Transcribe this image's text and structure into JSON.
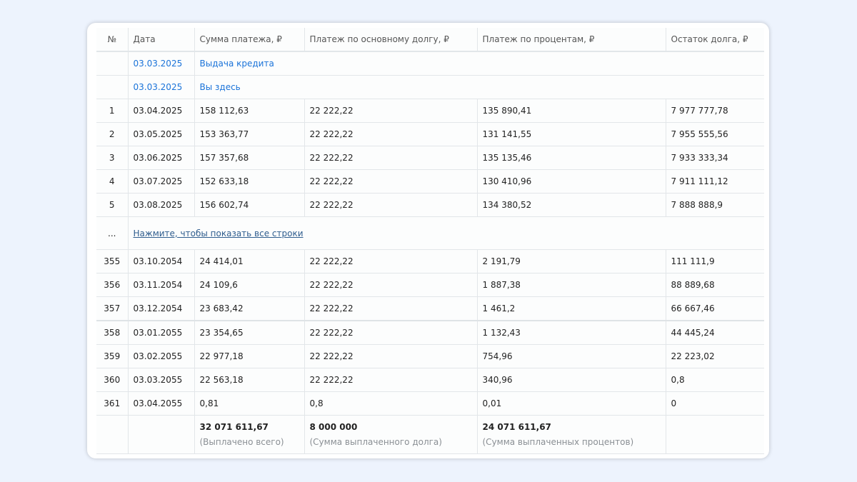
{
  "header": {
    "num": "№",
    "date": "Дата",
    "payment": "Сумма платежа, ₽",
    "principal": "Платеж по основному долгу, ₽",
    "interest": "Платеж по процентам, ₽",
    "balance": "Остаток долга, ₽"
  },
  "info_rows": [
    {
      "date": "03.03.2025",
      "label": "Выдача кредита"
    },
    {
      "date": "03.03.2025",
      "label": "Вы здесь"
    }
  ],
  "rows_top": [
    {
      "n": "1",
      "date": "03.04.2025",
      "payment": "158 112,63",
      "principal": "22 222,22",
      "interest": "135 890,41",
      "balance": "7 977 777,78"
    },
    {
      "n": "2",
      "date": "03.05.2025",
      "payment": "153 363,77",
      "principal": "22 222,22",
      "interest": "131 141,55",
      "balance": "7 955 555,56"
    },
    {
      "n": "3",
      "date": "03.06.2025",
      "payment": "157 357,68",
      "principal": "22 222,22",
      "interest": "135 135,46",
      "balance": "7 933 333,34"
    },
    {
      "n": "4",
      "date": "03.07.2025",
      "payment": "152 633,18",
      "principal": "22 222,22",
      "interest": "130 410,96",
      "balance": "7 911 111,12"
    },
    {
      "n": "5",
      "date": "03.08.2025",
      "payment": "156 602,74",
      "principal": "22 222,22",
      "interest": "134 380,52",
      "balance": "7 888 888,9"
    }
  ],
  "ellipsis": {
    "dots": "...",
    "show_all": "Нажмите, чтобы показать все строки"
  },
  "rows_bottom": [
    {
      "n": "355",
      "date": "03.10.2054",
      "payment": "24 414,01",
      "principal": "22 222,22",
      "interest": "2 191,79",
      "balance": "111 111,9"
    },
    {
      "n": "356",
      "date": "03.11.2054",
      "payment": "24 109,6",
      "principal": "22 222,22",
      "interest": "1 887,38",
      "balance": "88 889,68"
    },
    {
      "n": "357",
      "date": "03.12.2054",
      "payment": "23 683,42",
      "principal": "22 222,22",
      "interest": "1 461,2",
      "balance": "66 667,46"
    },
    {
      "n": "358",
      "date": "03.01.2055",
      "payment": "23 354,65",
      "principal": "22 222,22",
      "interest": "1 132,43",
      "balance": "44 445,24"
    },
    {
      "n": "359",
      "date": "03.02.2055",
      "payment": "22 977,18",
      "principal": "22 222,22",
      "interest": "754,96",
      "balance": "22 223,02"
    },
    {
      "n": "360",
      "date": "03.03.2055",
      "payment": "22 563,18",
      "principal": "22 222,22",
      "interest": "340,96",
      "balance": "0,8"
    },
    {
      "n": "361",
      "date": "03.04.2055",
      "payment": "0,81",
      "principal": "0,8",
      "interest": "0,01",
      "balance": "0"
    }
  ],
  "totals": {
    "payment": "32 071 611,67",
    "payment_caption": "(Выплачено всего)",
    "principal": "8 000 000",
    "principal_caption": "(Сумма выплаченного долга)",
    "interest": "24 071 611,67",
    "interest_caption": "(Сумма выплаченных процентов)"
  },
  "colors": {
    "accent": "#1a73d9",
    "link": "#2f5d8e",
    "page_bg": "#edf3fd"
  }
}
